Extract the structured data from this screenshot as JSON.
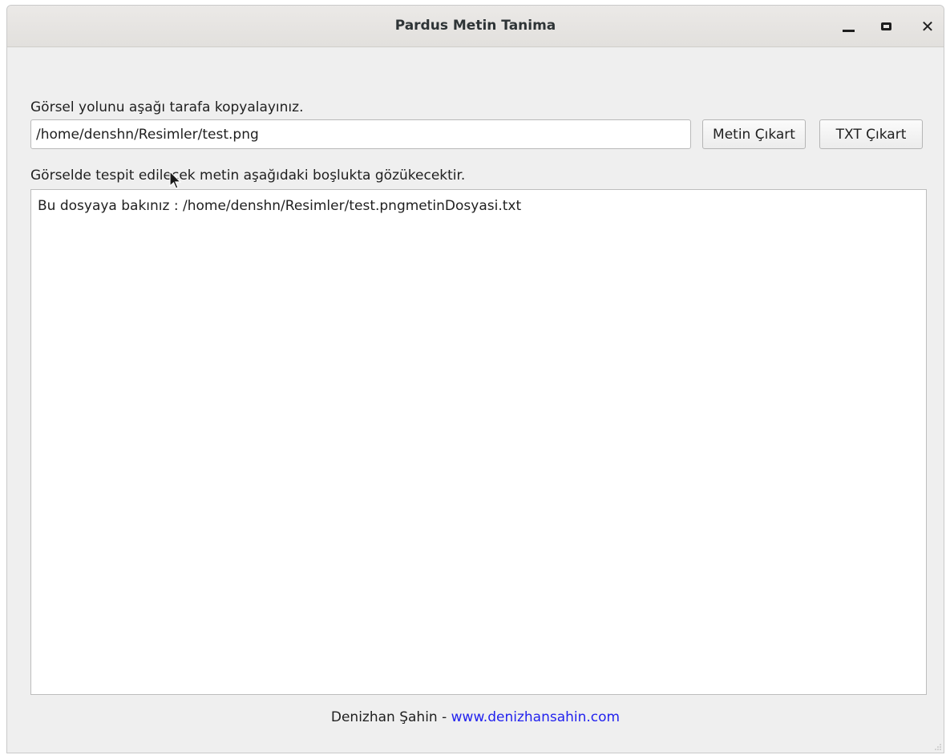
{
  "window": {
    "title": "Pardus Metin Tanima"
  },
  "form": {
    "path_label": "Görsel yolunu aşağı tarafa kopyalayınız.",
    "path_value": "/home/denshn/Resimler/test.png",
    "extract_button_label": "Metin Çıkart",
    "txt_button_label": "TXT Çıkart",
    "result_label": "Görselde tespit edilecek metin aşağıdaki boşlukta gözükecektir.",
    "result_text": "Bu dosyaya bakınız : /home/denshn/Resimler/test.pngmetinDosyasi.txt"
  },
  "footer": {
    "author": "Denizhan Şahin",
    "separator": " - ",
    "link": "www.denizhansahin.com"
  },
  "colors": {
    "link": "#2222ee",
    "window_bg": "#efefef",
    "titlebar_bg": "#e4e2df"
  },
  "icons": {
    "minimize": "minimize-icon",
    "maximize": "maximize-icon",
    "close": "close-icon",
    "cursor": "mouse-pointer-icon"
  }
}
